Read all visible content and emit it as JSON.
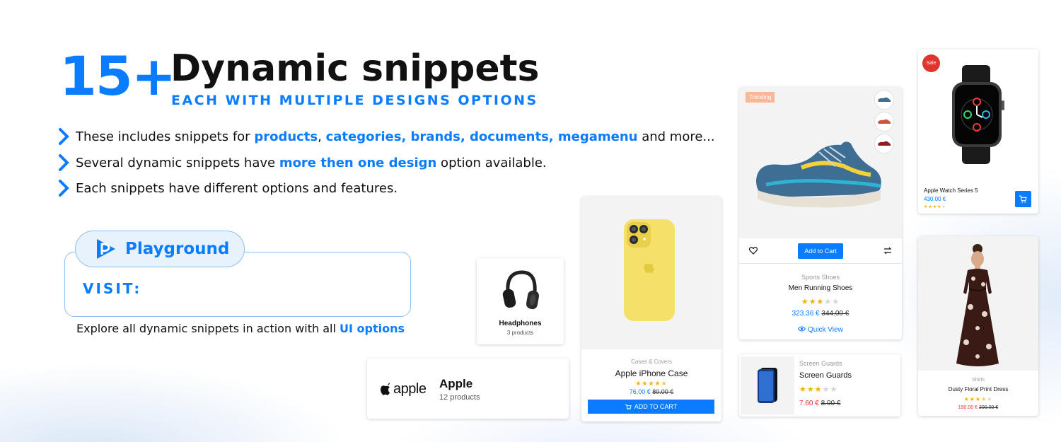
{
  "header": {
    "big_number": "15+",
    "title": "Dynamic snippets",
    "subtitle": "EACH WITH MULTIPLE DESIGNS OPTIONS"
  },
  "bullets": [
    {
      "pre": "These includes snippets for ",
      "hl1": "products",
      "mid": ", ",
      "hl2": "categories, brands, documents, megamenu",
      "post": " and more..."
    },
    {
      "pre": "Several dynamic snippets have ",
      "hl1": "more then one design",
      "post": " option available."
    },
    {
      "text": "Each snippets have different options and features."
    }
  ],
  "playground": {
    "label": "Playground",
    "visit": "VISIT:",
    "explore_pre": "Explore all dynamic snippets in action with all ",
    "explore_hl": "UI options"
  },
  "cards": {
    "headphones": {
      "name": "Headphones",
      "count": "3 products"
    },
    "apple": {
      "logo_text": "apple",
      "name": "Apple",
      "count": "12 products"
    },
    "iphone_case": {
      "category": "Cases & Covers",
      "name": "Apple iPhone Case",
      "price": "76.00 €",
      "old_price": "80.00 €",
      "button": "ADD TO CART",
      "rating": 4.5
    },
    "shoes": {
      "badge": "Trending",
      "add_button": "Add to Cart",
      "category": "Sports Shoes",
      "name": "Men Running Shoes",
      "price": "323.36 €",
      "old_price": "344.00 €",
      "quick_view": "Quick View",
      "rating": 3
    },
    "screen_guard": {
      "category": "Screen Guards",
      "name": "Screen Guards",
      "price": "7.60 €",
      "old_price": "8.00 €",
      "rating": 3
    },
    "watch": {
      "badge": "Sale",
      "name": "Apple Watch Series 5",
      "price": "430.00 €",
      "rating": 4
    },
    "dress": {
      "category": "Shirts",
      "name": "Dusty Floral Print Dress",
      "price": "190.00 €",
      "old_price": "200.00 €",
      "rating": 3.5
    }
  },
  "colors": {
    "accent": "#0a7cff",
    "sale": "#e2342c",
    "trending": "#f8b896",
    "star": "#f3b000"
  }
}
